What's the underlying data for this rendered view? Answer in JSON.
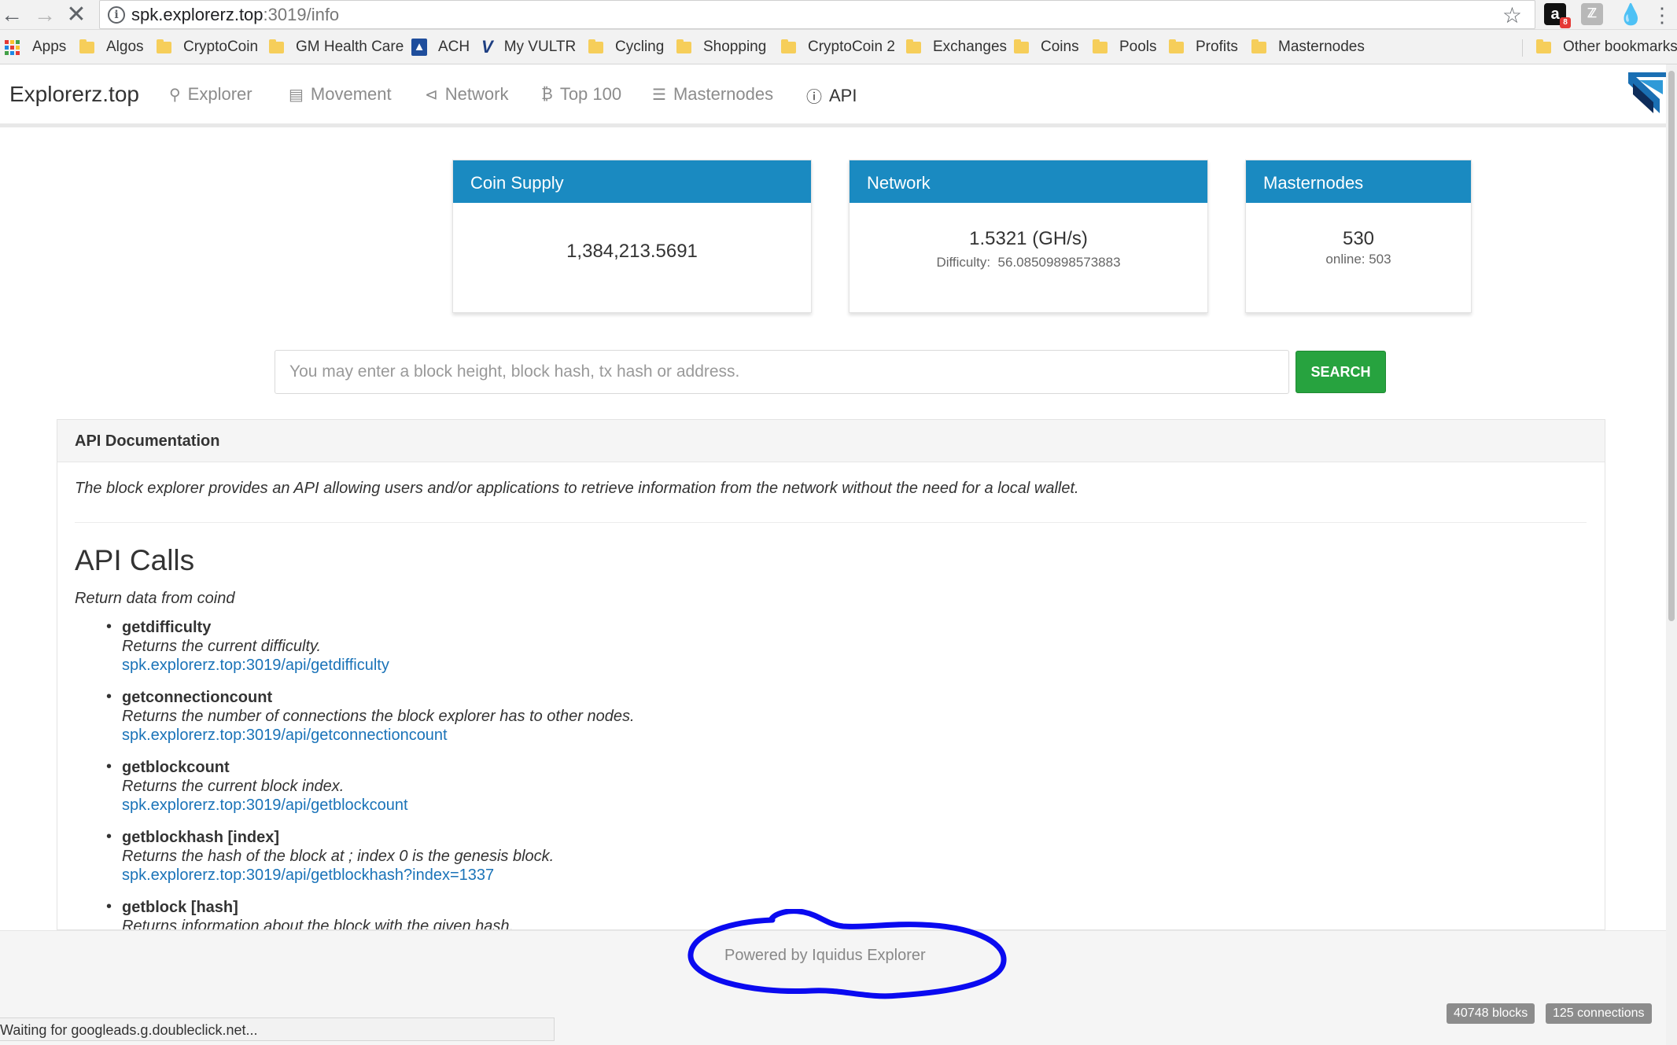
{
  "browser": {
    "url_host": "spk.explorerz.top",
    "url_path": ":3019/info",
    "ext_badge_count": "8",
    "bookmarks": [
      {
        "label": "Apps",
        "icon": "apps-grid-icon"
      },
      {
        "label": "Algos",
        "icon": "folder-icon"
      },
      {
        "label": "CryptoCoin",
        "icon": "folder-icon"
      },
      {
        "label": "GM Health Care",
        "icon": "folder-icon"
      },
      {
        "label": "ACH",
        "icon": "ach-icon"
      },
      {
        "label": "My VULTR",
        "icon": "vultr-icon"
      },
      {
        "label": "Cycling",
        "icon": "folder-icon"
      },
      {
        "label": "Shopping",
        "icon": "folder-icon"
      },
      {
        "label": "CryptoCoin 2",
        "icon": "folder-icon"
      },
      {
        "label": "Exchanges",
        "icon": "folder-icon"
      },
      {
        "label": "Coins",
        "icon": "folder-icon"
      },
      {
        "label": "Pools",
        "icon": "folder-icon"
      },
      {
        "label": "Profits",
        "icon": "folder-icon"
      },
      {
        "label": "Masternodes",
        "icon": "folder-icon"
      }
    ],
    "other_bookmarks": "Other bookmarks",
    "status_text": "Waiting for googleads.g.doubleclick.net..."
  },
  "site": {
    "brand": "Explorerz.top",
    "nav": [
      {
        "label": "Explorer",
        "icon": "search-icon"
      },
      {
        "label": "Movement",
        "icon": "money-icon"
      },
      {
        "label": "Network",
        "icon": "share-icon"
      },
      {
        "label": "Top 100",
        "icon": "bitcoin-icon"
      },
      {
        "label": "Masternodes",
        "icon": "list-icon"
      },
      {
        "label": "API",
        "icon": "info-icon"
      }
    ],
    "accent_color": "#1a8ac1",
    "search_color": "#27a33f"
  },
  "stats": {
    "coin_supply": {
      "title": "Coin Supply",
      "value": "1,384,213.5691"
    },
    "network": {
      "title": "Network",
      "value": "1.5321 (GH/s)",
      "difficulty_label": "Difficulty:",
      "difficulty_value": "56.08509898573883"
    },
    "masternodes": {
      "title": "Masternodes",
      "value": "530",
      "online": "online: 503"
    }
  },
  "search": {
    "placeholder": "You may enter a block height, block hash, tx hash or address.",
    "button": "SEARCH"
  },
  "api_doc": {
    "header": "API Documentation",
    "intro": "The block explorer provides an API allowing users and/or applications to retrieve information from the network without the need for a local wallet.",
    "calls_title": "API Calls",
    "calls_subtitle": "Return data from coind",
    "calls": [
      {
        "name": "getdifficulty",
        "desc": "Returns the current difficulty.",
        "link": "spk.explorerz.top:3019/api/getdifficulty"
      },
      {
        "name": "getconnectioncount",
        "desc": "Returns the number of connections the block explorer has to other nodes.",
        "link": "spk.explorerz.top:3019/api/getconnectioncount"
      },
      {
        "name": "getblockcount",
        "desc": "Returns the current block index.",
        "link": "spk.explorerz.top:3019/api/getblockcount"
      },
      {
        "name": "getblockhash [index]",
        "desc": "Returns the hash of the block at ; index 0 is the genesis block.",
        "link": "spk.explorerz.top:3019/api/getblockhash?index=1337"
      },
      {
        "name": "getblock [hash]",
        "desc": "Returns information about the block with the given hash.",
        "link": ""
      }
    ]
  },
  "footer": {
    "powered_by": "Powered by Iquidus Explorer",
    "blocks_badge": "40748 blocks",
    "connections_badge": "125 connections",
    "annotation_color": "#0a0af0"
  }
}
